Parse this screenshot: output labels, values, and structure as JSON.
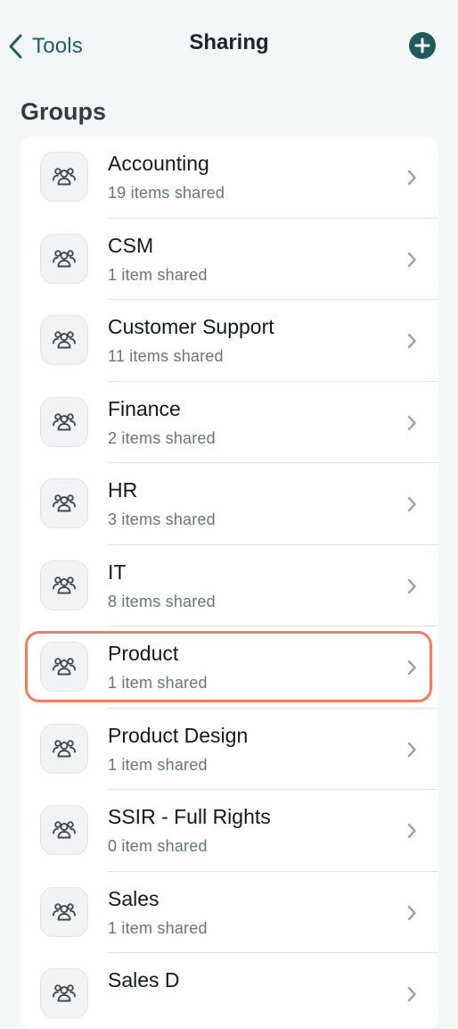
{
  "nav": {
    "back_label": "Tools",
    "title": "Sharing",
    "add_icon": "plus-circle-icon"
  },
  "section_title": "Groups",
  "colors": {
    "accent": "#1f5a5e",
    "highlight": "#ef7d64",
    "background": "#f3f7f8"
  },
  "groups": [
    {
      "name": "Accounting",
      "shared": "19 items shared"
    },
    {
      "name": "CSM",
      "shared": "1 item shared"
    },
    {
      "name": "Customer Support",
      "shared": "11 items shared"
    },
    {
      "name": "Finance",
      "shared": "2 items shared"
    },
    {
      "name": "HR",
      "shared": "3 items shared"
    },
    {
      "name": "IT",
      "shared": "8 items shared"
    },
    {
      "name": "Product",
      "shared": "1 item shared",
      "highlighted": true
    },
    {
      "name": "Product Design",
      "shared": "1 item shared"
    },
    {
      "name": "SSIR - Full Rights",
      "shared": "0 item shared"
    },
    {
      "name": "Sales",
      "shared": "1 item shared"
    },
    {
      "name": "Sales D",
      "shared": ""
    }
  ]
}
